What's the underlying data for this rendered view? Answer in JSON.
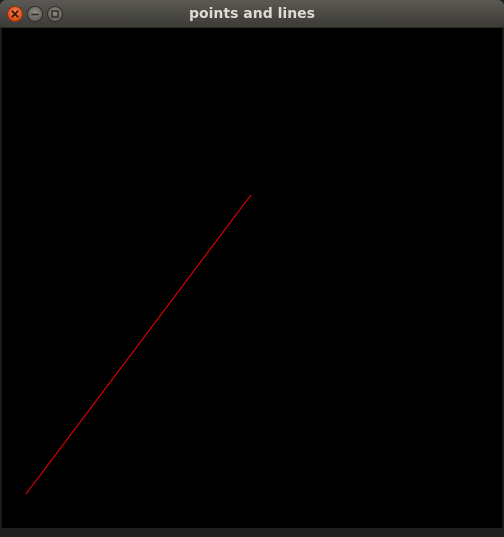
{
  "window": {
    "title": "points and lines"
  },
  "titlebar_buttons": [
    {
      "name": "close",
      "icon": "close-icon",
      "color": "#df4a16"
    },
    {
      "name": "minimize",
      "icon": "minimize-icon",
      "color": "#65635d"
    },
    {
      "name": "maximize",
      "icon": "maximize-icon",
      "color": "#65635d"
    }
  ],
  "canvas": {
    "background": "#000000",
    "line_color": "#ff0000"
  }
}
